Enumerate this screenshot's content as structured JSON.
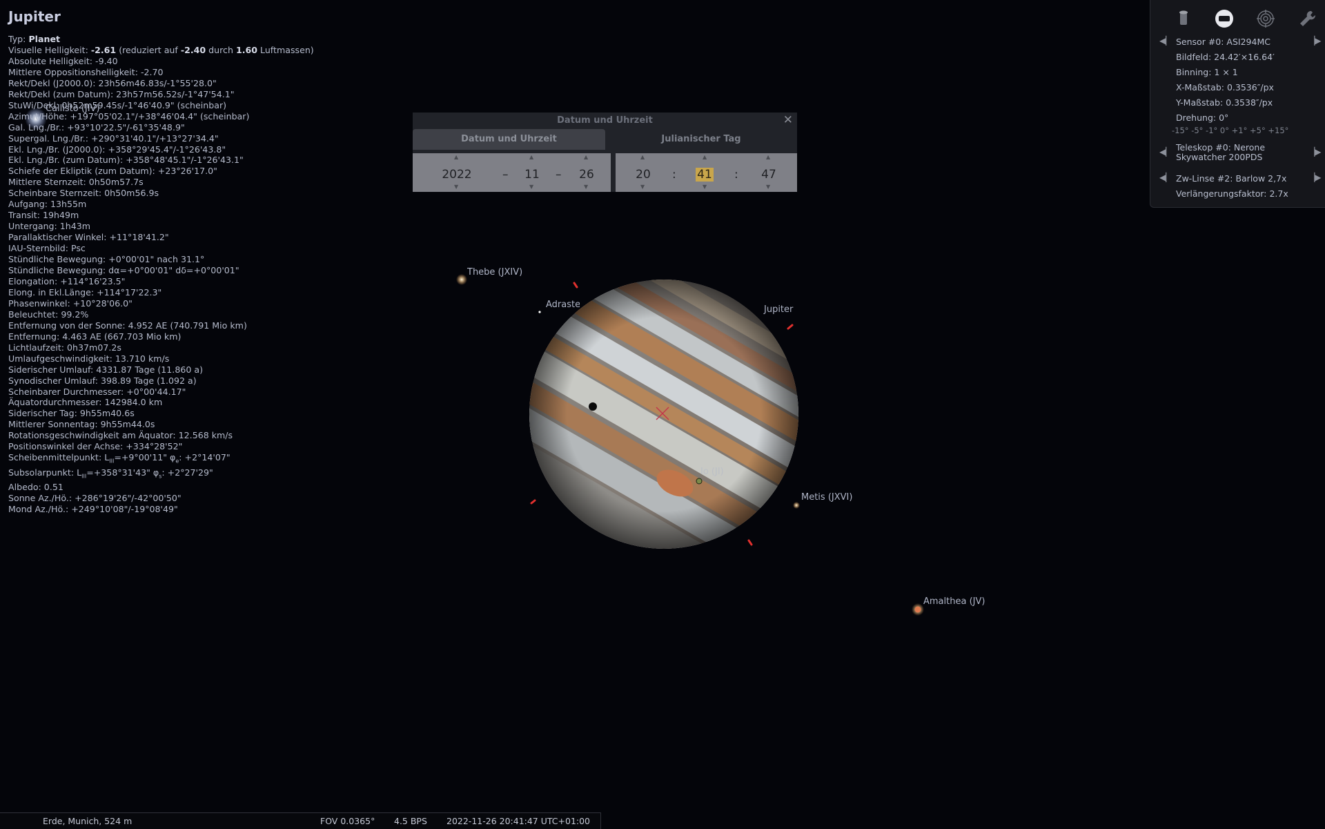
{
  "object": {
    "name": "Jupiter",
    "lines": [
      {
        "label": "Typ: ",
        "value": "Planet",
        "bold": true
      },
      {
        "label": "Visuelle Helligkeit: ",
        "rich": [
          [
            "b",
            "-2.61"
          ],
          [
            "t",
            " (reduziert auf "
          ],
          [
            "b",
            "-2.40"
          ],
          [
            "t",
            " durch "
          ],
          [
            "b",
            "1.60"
          ],
          [
            "t",
            " Luftmassen)"
          ]
        ]
      },
      {
        "label": "Absolute Helligkeit: -9.40"
      },
      {
        "label": "Mittlere Oppositionshelligkeit: -2.70"
      },
      {
        "label": "Rekt/Dekl (J2000.0): 23h56m46.83s/-1°55'28.0\""
      },
      {
        "label": "Rekt/Dekl (zum Datum): 23h57m56.52s/-1°47'54.1\""
      },
      {
        "label": "StuWi/Dekl: 0h52m59.45s/-1°46'40.9\" (scheinbar)"
      },
      {
        "label": "Azimut/Höhe: +197°05'02.1\"/+38°46'04.4\" (scheinbar)"
      },
      {
        "label": "Gal. Lng./Br.: +93°10'22.5\"/-61°35'48.9\""
      },
      {
        "label": "Supergal. Lng./Br.: +290°31'40.1\"/+13°27'34.4\""
      },
      {
        "label": "Ekl. Lng./Br. (J2000.0): +358°29'45.4\"/-1°26'43.8\""
      },
      {
        "label": "Ekl. Lng./Br. (zum Datum): +358°48'45.1\"/-1°26'43.1\""
      },
      {
        "label": "Schiefe der Ekliptik (zum Datum): +23°26'17.0\""
      },
      {
        "label": "Mittlere Sternzeit: 0h50m57.7s"
      },
      {
        "label": "Scheinbare Sternzeit: 0h50m56.9s"
      },
      {
        "label": "Aufgang: 13h55m"
      },
      {
        "label": "Transit: 19h49m"
      },
      {
        "label": "Untergang: 1h43m"
      },
      {
        "label": "Parallaktischer Winkel: +11°18'41.2\""
      },
      {
        "label": "IAU-Sternbild: Psc"
      },
      {
        "label": "Stündliche Bewegung: +0°00'01\" nach 31.1°"
      },
      {
        "label": "Stündliche Bewegung: dα=+0°00'01\" dδ=+0°00'01\""
      },
      {
        "label": "Elongation: +114°16'23.5\""
      },
      {
        "label": "Elong. in Ekl.Länge: +114°17'22.3\""
      },
      {
        "label": "Phasenwinkel: +10°28'06.0\""
      },
      {
        "label": "Beleuchtet: 99.2%"
      },
      {
        "label": "Entfernung von der Sonne: 4.952 AE (740.791 Mio km)"
      },
      {
        "label": "Entfernung: 4.463 AE (667.703 Mio km)"
      },
      {
        "label": "Lichtlaufzeit: 0h37m07.2s"
      },
      {
        "label": "Umlaufgeschwindigkeit: 13.710 km/s"
      },
      {
        "label": "Siderischer Umlauf: 4331.87 Tage (11.860 a)"
      },
      {
        "label": "Synodischer Umlauf: 398.89 Tage (1.092 a)"
      },
      {
        "label": "Scheinbarer Durchmesser: +0°00'44.17\""
      },
      {
        "label": "Äquatordurchmesser: 142984.0 km"
      },
      {
        "label": "Siderischer Tag: 9h55m40.6s"
      },
      {
        "label": "Mittlerer Sonnentag: 9h55m44.0s"
      },
      {
        "label": "Rotationsgeschwindigkeit am Äquator: 12.568 km/s"
      },
      {
        "label": "Positionswinkel der Achse: +334°28'52\""
      },
      {
        "label": "Scheibenmittelpunkt: ",
        "rich": [
          [
            "t",
            "L"
          ],
          [
            "s",
            "III"
          ],
          [
            "t",
            "=+9°00'11\" φ"
          ],
          [
            "s",
            "e"
          ],
          [
            "t",
            ": +2°14'07\""
          ]
        ]
      },
      {
        "label": "Subsolarpunkt: ",
        "rich": [
          [
            "t",
            "L"
          ],
          [
            "s",
            "III"
          ],
          [
            "t",
            "=+358°31'43\" φ"
          ],
          [
            "s",
            "s"
          ],
          [
            "t",
            ": +2°27'29\""
          ]
        ]
      },
      {
        "label": "Albedo: 0.51"
      },
      {
        "label": "Sonne Az./Hö.: +286°19'26\"/-42°00'50\""
      },
      {
        "label": "Mond Az./Hö.: +249°10'08\"/-19°08'49\""
      }
    ]
  },
  "dialog": {
    "title": "Datum und Uhrzeit",
    "tab_date": "Datum und Uhrzeit",
    "tab_jd": "Julianischer Tag",
    "year": "2022",
    "month": "11",
    "day": "26",
    "hour": "20",
    "minute": "41",
    "second": "47",
    "date_sep": "–",
    "time_sep": ":",
    "close": "✕"
  },
  "ocular": {
    "sensor": "Sensor #0: ASI294MC",
    "fov": "Bildfeld: 24.42′×16.64′",
    "binning": "Binning: 1 × 1",
    "xscale": "X-Maßstab: 0.3536″/px",
    "yscale": "Y-Maßstab: 0.3538″/px",
    "rotation": "Drehung: 0°",
    "rotation_steps": "-15° -5° -1° 0° +1° +5° +15°",
    "telescope": "Teleskop #0: Nerone\nSkywatcher 200PDS",
    "lens": "Zw-Linse #2: Barlow 2,7x",
    "factor": "Verlängerungsfaktor: 2.7x",
    "icons": [
      "ocular-icon",
      "sensor-icon",
      "telrad-icon",
      "settings-wrench-icon"
    ]
  },
  "sky_labels": {
    "callisto": "Callisto (JIV)",
    "thebe": "Thebe (JXIV)",
    "adrastea": "Adrastea",
    "jupiter": "Jupiter",
    "io": "Io (JI)",
    "metis": "Metis (JXVI)",
    "amalthea": "Amalthea (JV)"
  },
  "status": {
    "location": "Erde, Munich, 524 m",
    "fov": "FOV 0.0365°",
    "fps": "4.5 BPS",
    "datetime": "2022-11-26 20:41:47 UTC+01:00"
  },
  "colors": {
    "background": "#04050a",
    "dialog_highlight": "#c9a64b",
    "marker_red": "#e0302e"
  }
}
